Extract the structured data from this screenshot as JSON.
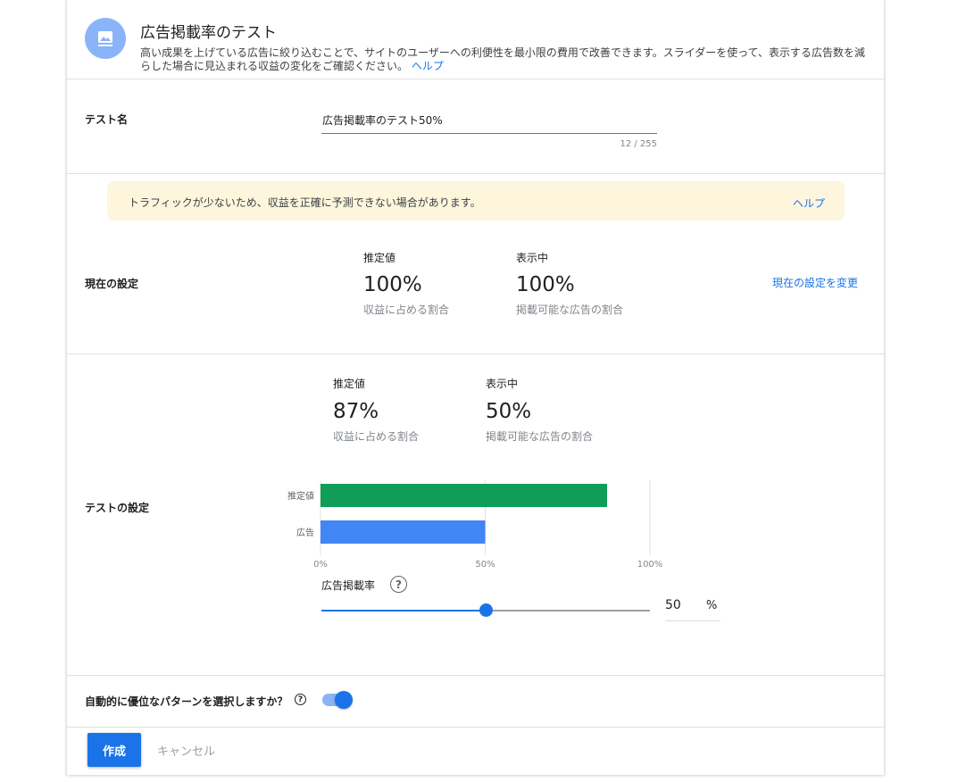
{
  "header": {
    "icon": "image-icon",
    "title": "広告掲載率のテスト",
    "description": "高い成果を上げている広告に絞り込むことで、サイトのユーザーへの利便性を最小限の費用で改善できます。スライダーを使って、表示する広告数を減らした場合に見込まれる収益の変化をご確認ください。",
    "help_link": "ヘルプ"
  },
  "test_name": {
    "label": "テスト名",
    "value": "広告掲載率のテスト50%",
    "counter": "12 / 255"
  },
  "warning": {
    "text": "トラフィックが少ないため、収益を正確に予測できない場合があります。",
    "help_link": "ヘルプ"
  },
  "current_settings": {
    "label": "現在の設定",
    "estimate_label": "推定値",
    "estimate_value": "100%",
    "estimate_sub": "収益に占める割合",
    "showing_label": "表示中",
    "showing_value": "100%",
    "showing_sub": "掲載可能な広告の割合",
    "change_link": "現在の設定を変更"
  },
  "test_settings": {
    "label": "テストの設定",
    "estimate_label": "推定値",
    "estimate_value": "87%",
    "estimate_sub": "収益に占める割合",
    "showing_label": "表示中",
    "showing_value": "50%",
    "showing_sub": "掲載可能な広告の割合"
  },
  "chart_data": {
    "type": "bar",
    "orientation": "horizontal",
    "categories": [
      "推定値",
      "広告"
    ],
    "values": [
      87,
      50
    ],
    "colors": [
      "#0f9d58",
      "#4285f4"
    ],
    "xlim": [
      0,
      100
    ],
    "xticks": [
      "0%",
      "50%",
      "100%"
    ],
    "grid": true
  },
  "slider": {
    "label": "広告掲載率",
    "help_icon": "help-circle-icon",
    "value": 50,
    "display_value": "50",
    "unit": "%",
    "accent": "#1a73e8"
  },
  "auto_select": {
    "label": "自動的に優位なパターンを選択しますか？",
    "help_icon": "help-circle-icon",
    "toggle_on": true
  },
  "footer": {
    "create_label": "作成",
    "cancel_label": "キャンセル"
  },
  "colors": {
    "accent": "#1a73e8",
    "banner": "#fdf6dd",
    "estimate_bar": "#0f9d58",
    "ads_bar": "#4285f4"
  }
}
